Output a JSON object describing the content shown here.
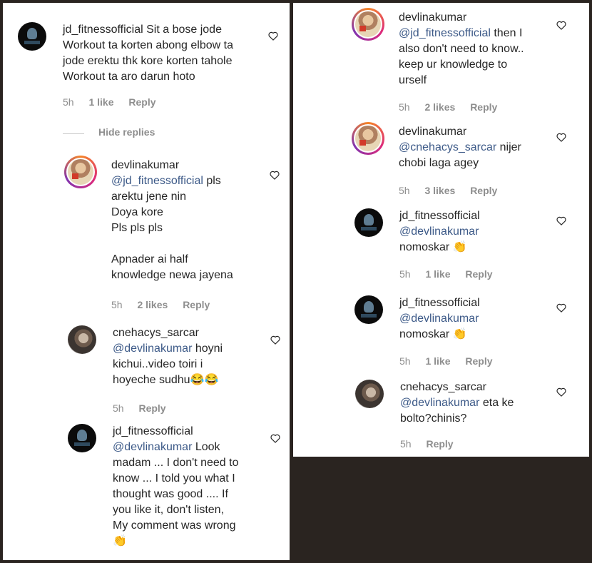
{
  "left": {
    "c1": {
      "user": "jd_fitnessofficial",
      "lines": [
        "Sit a bose jode",
        "Workout ta korten abong elbow ta",
        "jode erektu thk kore korten tahole",
        "Workout ta aro darun hoto"
      ],
      "time": "5h",
      "likes": "1 like",
      "reply": "Reply"
    },
    "hide_replies": "Hide replies",
    "c2": {
      "user": "devlinakumar",
      "mention": "@jd_fitnessofficial",
      "first_tail": " pls",
      "lines": [
        "arektu jene nin",
        "Doya kore",
        "Pls pls pls",
        "",
        "Apnader ai half",
        "knowledge newa jayena"
      ],
      "time": "5h",
      "likes": "2 likes",
      "reply": "Reply"
    },
    "c3": {
      "user": "cnehacys_sarcar",
      "mention": "@devlinakumar",
      "first_tail": " hoyni",
      "lines": [
        "kichui..video toiri i",
        "hoyeche sudhu"
      ],
      "emoji": "😂😂",
      "time": "5h",
      "reply": "Reply"
    },
    "c4": {
      "user": "jd_fitnessofficial",
      "mention": "@devlinakumar",
      "first_tail": " Look",
      "lines": [
        "madam ... I don't need to",
        "know ... I told you what I",
        "thought was good .... If",
        "you like it, don't listen,",
        "My comment was wrong"
      ],
      "emoji": "👏",
      "time": "",
      "reply": ""
    }
  },
  "right": {
    "c1": {
      "user": "devlinakumar",
      "mention": "@jd_fitnessofficial",
      "first_tail": " then I",
      "lines": [
        "also don't need to know..",
        "keep ur knowledge to",
        "urself"
      ],
      "time": "5h",
      "likes": "2 likes",
      "reply": "Reply"
    },
    "c2": {
      "user": "devlinakumar",
      "mention": "@cnehacys_sarcar",
      "first_tail": " nijer",
      "lines": [
        "chobi laga agey"
      ],
      "time": "5h",
      "likes": "3 likes",
      "reply": "Reply"
    },
    "c3": {
      "user": "jd_fitnessofficial",
      "mention": "@devlinakumar",
      "lines": [
        "nomoskar"
      ],
      "emoji": "👏",
      "time": "5h",
      "likes": "1 like",
      "reply": "Reply"
    },
    "c4": {
      "user": "jd_fitnessofficial",
      "mention": "@devlinakumar",
      "lines": [
        "nomoskar"
      ],
      "emoji": "👏",
      "time": "5h",
      "likes": "1 like",
      "reply": "Reply"
    },
    "c5": {
      "user": "cnehacys_sarcar",
      "mention": "@devlinakumar",
      "first_tail": " eta ke",
      "lines": [
        "bolto?chinis?"
      ],
      "time": "5h",
      "reply": "Reply"
    }
  },
  "icons": {
    "like": "heart-outline-icon",
    "avatar_jd": "jd-fitness-logo",
    "avatar_dk": "devlina-photo",
    "avatar_cn": "cnehacys-photo"
  }
}
